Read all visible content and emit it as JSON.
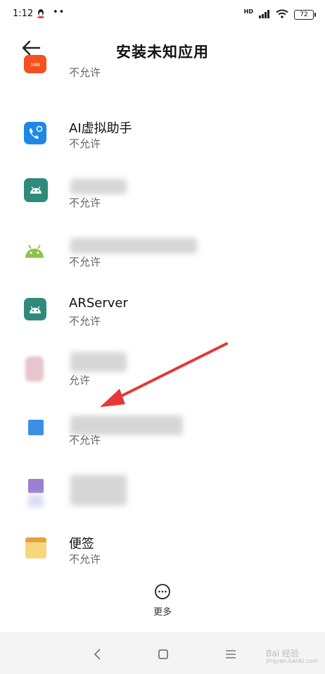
{
  "status_bar": {
    "time": "1:12",
    "dots": "••",
    "hd": "HD",
    "battery": "72"
  },
  "header": {
    "title": "安装未知应用"
  },
  "apps": [
    {
      "name": "",
      "status": "不允许",
      "icon": "1688-app-icon",
      "color": "#f4511e"
    },
    {
      "name": "AI虚拟助手",
      "status": "不允许",
      "icon": "ai-assistant-phone-icon",
      "color": "#1e88e5"
    },
    {
      "name": "",
      "status": "不允许",
      "icon": "android-robot-icon",
      "color": "#2e8b7a"
    },
    {
      "name": "",
      "status": "不允许",
      "icon": "android-robot-icon",
      "color": "#8bc34a"
    },
    {
      "name": "ARServer",
      "status": "不允许",
      "icon": "android-robot-icon",
      "color": "#2e8b7a"
    },
    {
      "name": "",
      "status": "允许",
      "icon": "blurred-app-icon",
      "color": "#e8c5cc"
    },
    {
      "name": "",
      "status": "不允许",
      "icon": "blurred-app-icon",
      "color": "#3d8ee6"
    },
    {
      "name": "",
      "status": "",
      "icon": "blurred-app-icon",
      "color": "#9b7fd0"
    },
    {
      "name": "便签",
      "status": "不允许",
      "icon": "notes-icon",
      "color": "#f5c242"
    }
  ],
  "more": {
    "label": "更多"
  },
  "watermark": {
    "line1": "Bai 经验",
    "line2": "jingyan.baidu.com"
  }
}
